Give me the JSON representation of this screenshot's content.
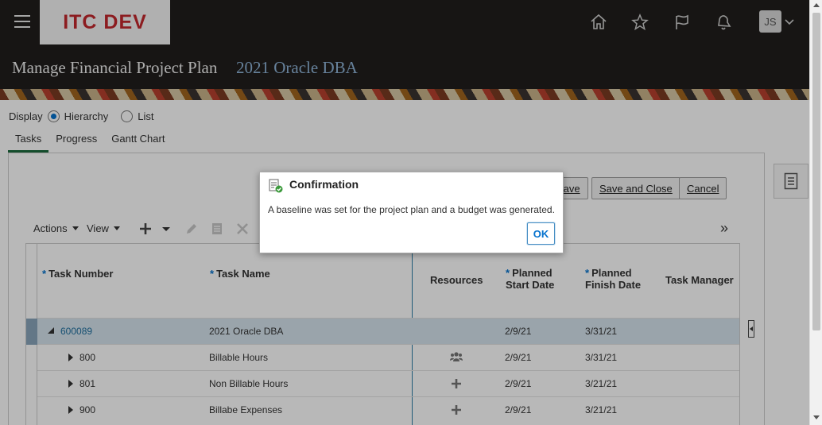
{
  "header": {
    "logo_text": "ITC DEV",
    "avatar_initials": "JS",
    "icons": [
      "hamburger-icon",
      "home-icon",
      "star-icon",
      "flag-icon",
      "bell-icon",
      "chevron-down-icon"
    ]
  },
  "page": {
    "title": "Manage Financial Project Plan",
    "subtitle": "2021 Oracle DBA"
  },
  "display": {
    "label": "Display",
    "options": [
      "Hierarchy",
      "List"
    ],
    "selected": "Hierarchy"
  },
  "tabs": [
    {
      "label": "Tasks",
      "active": true
    },
    {
      "label": "Progress",
      "active": false
    },
    {
      "label": "Gantt Chart",
      "active": false
    }
  ],
  "buttons": {
    "save": "Save",
    "save_and_close": "Save and Close",
    "cancel": "Cancel"
  },
  "toolbar": {
    "actions": "Actions",
    "view": "View",
    "expand_glyph": "»"
  },
  "table": {
    "columns": {
      "task_number": "Task Number",
      "task_name": "Task Name",
      "resources": "Resources",
      "planned_start_1": "Planned",
      "planned_start_2": "Start Date",
      "planned_finish_1": "Planned",
      "planned_finish_2": "Finish Date",
      "task_manager": "Task Manager"
    },
    "rows": [
      {
        "number": "600089",
        "name": "2021 Oracle DBA",
        "resources": "",
        "start": "2/9/21",
        "finish": "3/31/21"
      },
      {
        "number": "800",
        "name": "Billable Hours",
        "resources": "people-icon",
        "start": "2/9/21",
        "finish": "3/31/21"
      },
      {
        "number": "801",
        "name": "Non Billable Hours",
        "resources": "plus-icon",
        "start": "2/9/21",
        "finish": "3/21/21"
      },
      {
        "number": "900",
        "name": "Billabe Expenses",
        "resources": "plus-icon",
        "start": "2/9/21",
        "finish": "3/21/21"
      }
    ]
  },
  "dialog": {
    "title": "Confirmation",
    "message": "A baseline was set for the project plan and a budget was generated.",
    "ok_label": "OK"
  },
  "colors": {
    "header_bg": "#201e1c",
    "logo_red": "#c3282d",
    "subtitle_blue": "#8fb4d8",
    "link_blue": "#1f6f9e",
    "accent_blue": "#0572ce",
    "tab_underline": "#1c6b3d",
    "selected_row": "#d6e4ee"
  }
}
